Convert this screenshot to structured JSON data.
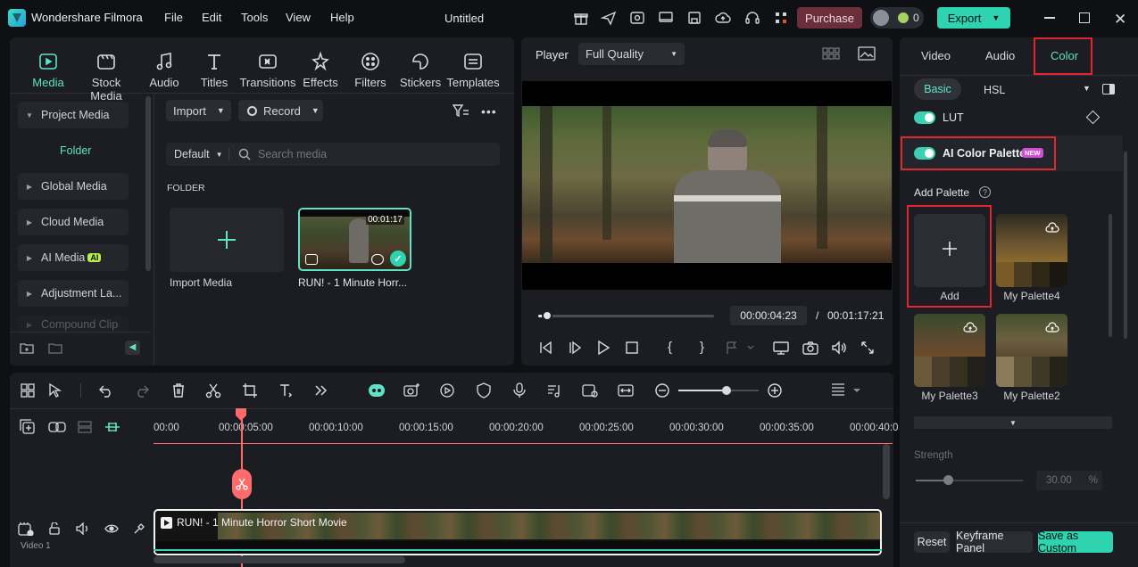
{
  "app": {
    "name": "Wondershare Filmora",
    "project_title": "Untitled"
  },
  "menu": [
    "File",
    "Edit",
    "Tools",
    "View",
    "Help"
  ],
  "header": {
    "purchase_label": "Purchase",
    "credits": "0",
    "export_label": "Export"
  },
  "toolbar_tabs": [
    {
      "label": "Media",
      "icon": "media-icon",
      "active": true
    },
    {
      "label": "Stock Media",
      "icon": "stock-media-icon"
    },
    {
      "label": "Audio",
      "icon": "audio-icon"
    },
    {
      "label": "Titles",
      "icon": "titles-icon"
    },
    {
      "label": "Transitions",
      "icon": "transitions-icon"
    },
    {
      "label": "Effects",
      "icon": "effects-icon"
    },
    {
      "label": "Filters",
      "icon": "filters-icon"
    },
    {
      "label": "Stickers",
      "icon": "stickers-icon"
    },
    {
      "label": "Templates",
      "icon": "templates-icon"
    }
  ],
  "sidebar": {
    "project_media": "Project Media",
    "folder": "Folder",
    "items": [
      "Global Media",
      "Cloud Media",
      "AI Media",
      "Adjustment La...",
      "Compound Clip"
    ],
    "ai_badge": "AI"
  },
  "media": {
    "import_label": "Import",
    "record_label": "Record",
    "sort_label": "Default",
    "search_placeholder": "Search media",
    "folder_heading": "FOLDER",
    "import_media_label": "Import Media",
    "clip_name": "RUN! - 1 Minute Horr...",
    "clip_duration": "00:01:17"
  },
  "player": {
    "label": "Player",
    "quality": "Full Quality",
    "current_time": "00:00:04:23",
    "separator": "/",
    "total_time": "00:01:17:21",
    "progress": 0.04
  },
  "timeline": {
    "ruler": [
      "00:00",
      "00:00:05:00",
      "00:00:10:00",
      "00:00:15:00",
      "00:00:20:00",
      "00:00:25:00",
      "00:00:30:00",
      "00:00:35:00",
      "00:00:40:0"
    ],
    "track_name": "Video 1",
    "clip_title": "RUN! - 1 Minute Horror Short Movie",
    "zoom": 0.6
  },
  "right_panel": {
    "tabs": [
      "Video",
      "Audio",
      "Color"
    ],
    "active_tab": "Color",
    "subtabs": [
      "Basic",
      "HSL"
    ],
    "lut_label": "LUT",
    "ai_palette_label": "AI Color Palette",
    "new_badge": "NEW",
    "add_palette_label": "Add Palette",
    "add_label": "Add",
    "palettes": [
      "My Palette4",
      "My Palette3",
      "My Palette2"
    ],
    "strength_label": "Strength",
    "strength_value": "30.00",
    "strength_unit": "%",
    "strength_level": 0.3,
    "reset_label": "Reset",
    "keyframe_label": "Keyframe Panel",
    "save_custom_label": "Save as Custom"
  },
  "colors": {
    "accent": "#5fe3c6",
    "export": "#2ed3b0",
    "purchase": "#6a2f3a",
    "playhead": "#ff6b6b",
    "highlight": "#e0262f"
  }
}
